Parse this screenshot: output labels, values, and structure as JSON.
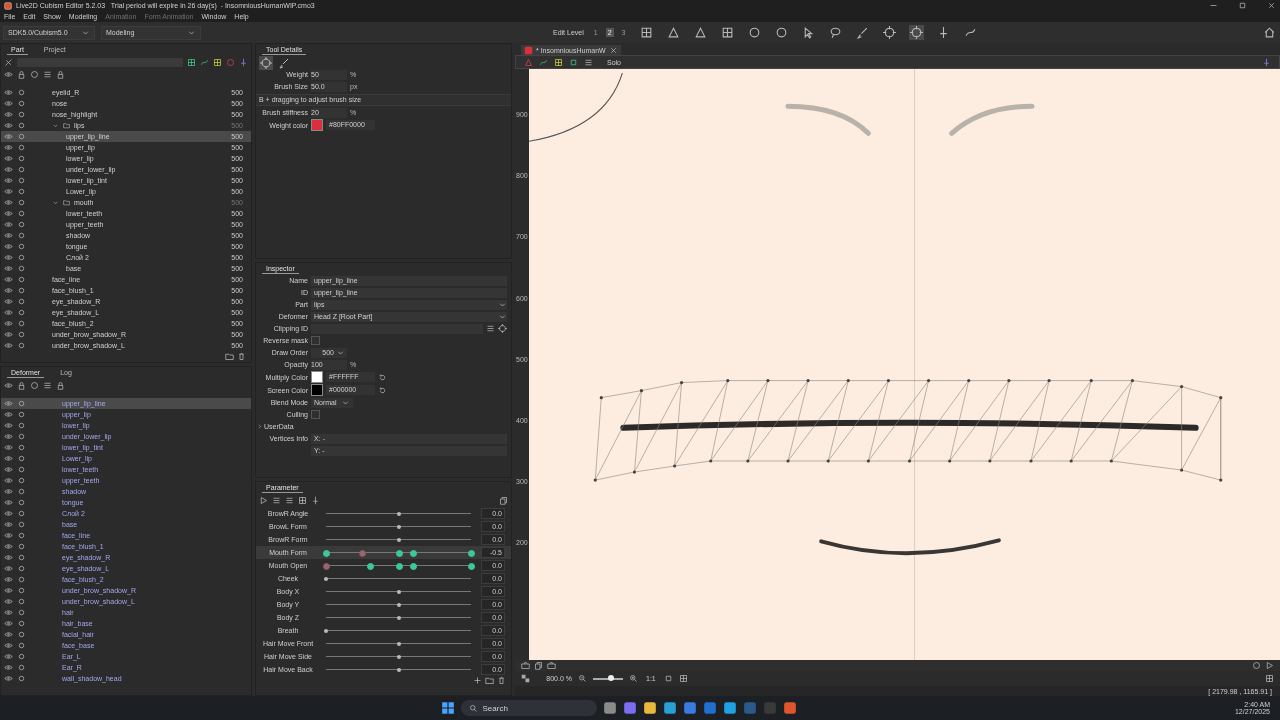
{
  "window": {
    "title": "Live2D Cubism Editor 5.2.03   Trial period will expire in 26 day(s)  - InsomniousHumanWIP.cmo3"
  },
  "menu": [
    {
      "label": "File",
      "disabled": false
    },
    {
      "label": "Edit",
      "disabled": false
    },
    {
      "label": "Show",
      "disabled": false
    },
    {
      "label": "Modeling",
      "disabled": false
    },
    {
      "label": "Animation",
      "disabled": true
    },
    {
      "label": "Form Animation",
      "disabled": true
    },
    {
      "label": "Window",
      "disabled": false
    },
    {
      "label": "Help",
      "disabled": false
    }
  ],
  "toolbar": {
    "sdk": "SDK5.0/Cubism5.0",
    "workspace": "Modeling",
    "edit_level_label": "Edit Level",
    "edit_levels": [
      {
        "label": "1",
        "selected": false
      },
      {
        "label": "2",
        "selected": true
      },
      {
        "label": "3",
        "selected": false
      }
    ]
  },
  "parts": {
    "tabs": [
      {
        "label": "Part",
        "selected": true
      },
      {
        "label": "Project",
        "selected": false
      }
    ],
    "items": [
      {
        "name": "eyelid_R",
        "order": "500",
        "selected": false
      },
      {
        "name": "nose",
        "order": "500",
        "selected": false
      },
      {
        "name": "nose_highlight",
        "order": "500",
        "selected": false
      },
      {
        "name": "lips",
        "order": "500",
        "selected": false,
        "expanded": true,
        "children": [
          {
            "name": "upper_lip_line",
            "order": "500",
            "selected": true
          },
          {
            "name": "upper_lip",
            "order": "500",
            "selected": false
          },
          {
            "name": "lower_lip",
            "order": "500",
            "selected": false
          },
          {
            "name": "under_lower_lip",
            "order": "500",
            "selected": false
          },
          {
            "name": "lower_lip_tint",
            "order": "500",
            "selected": false
          },
          {
            "name": "Lower_lip",
            "order": "500",
            "selected": false
          }
        ]
      },
      {
        "name": "mouth",
        "order": "500",
        "selected": false,
        "expanded": true,
        "children": [
          {
            "name": "lower_teeth",
            "order": "500",
            "selected": false
          },
          {
            "name": "upper_teeth",
            "order": "500",
            "selected": false
          },
          {
            "name": "shadow",
            "order": "500",
            "selected": false
          },
          {
            "name": "tongue",
            "order": "500",
            "selected": false
          },
          {
            "name": "Слой 2",
            "order": "500",
            "selected": false
          },
          {
            "name": "base",
            "order": "500",
            "selected": false
          }
        ]
      },
      {
        "name": "face_line",
        "order": "500",
        "selected": false
      },
      {
        "name": "face_blush_1",
        "order": "500",
        "selected": false
      },
      {
        "name": "eye_shadow_R",
        "order": "500",
        "selected": false
      },
      {
        "name": "eye_shadow_L",
        "order": "500",
        "selected": false
      },
      {
        "name": "face_blush_2",
        "order": "500",
        "selected": false
      },
      {
        "name": "under_brow_shadow_R",
        "order": "500",
        "selected": false
      },
      {
        "name": "under_brow_shadow_L",
        "order": "500",
        "selected": false
      }
    ]
  },
  "deformers": {
    "tabs": [
      {
        "label": "Deformer",
        "selected": true
      },
      {
        "label": "Log",
        "selected": false
      }
    ],
    "items": [
      {
        "name": "upper_lip_line",
        "selected": true
      },
      {
        "name": "upper_lip",
        "selected": false
      },
      {
        "name": "lower_lip",
        "selected": false
      },
      {
        "name": "under_lower_lip",
        "selected": false
      },
      {
        "name": "lower_lip_tint",
        "selected": false
      },
      {
        "name": "Lower_lip",
        "selected": false
      },
      {
        "name": "lower_teeth",
        "selected": false
      },
      {
        "name": "upper_teeth",
        "selected": false
      },
      {
        "name": "shadow",
        "selected": false
      },
      {
        "name": "tongue",
        "selected": false
      },
      {
        "name": "Слой 2",
        "selected": false
      },
      {
        "name": "base",
        "selected": false
      },
      {
        "name": "face_line",
        "selected": false
      },
      {
        "name": "face_blush_1",
        "selected": false
      },
      {
        "name": "eye_shadow_R",
        "selected": false
      },
      {
        "name": "eye_shadow_L",
        "selected": false
      },
      {
        "name": "face_blush_2",
        "selected": false
      },
      {
        "name": "under_brow_shadow_R",
        "selected": false
      },
      {
        "name": "under_brow_shadow_L",
        "selected": false
      },
      {
        "name": "hair",
        "selected": false
      },
      {
        "name": "hair_base",
        "selected": false
      },
      {
        "name": "facial_hair",
        "selected": false
      },
      {
        "name": "face_base",
        "selected": false
      },
      {
        "name": "Ear_L",
        "selected": false
      },
      {
        "name": "Ear_R",
        "selected": false
      },
      {
        "name": "wall_shadow_head",
        "selected": false
      }
    ]
  },
  "tool_details": {
    "title": "Tool Details",
    "fields": [
      {
        "kind": "number",
        "label": "Weight",
        "value": "50",
        "unit": "%"
      },
      {
        "kind": "number",
        "label": "Brush Size",
        "value": "50.0",
        "unit": "px"
      },
      {
        "kind": "hint",
        "text": "B + dragging to adjust brush size"
      },
      {
        "kind": "number",
        "label": "Brush stiffness",
        "value": "20",
        "unit": "%"
      },
      {
        "kind": "color",
        "label": "Weight color",
        "value": "#80FF0000",
        "color": "#d9303a"
      }
    ]
  },
  "inspector": {
    "title": "Inspector",
    "fields": [
      {
        "kind": "text",
        "label": "Name",
        "value": "upper_lip_line"
      },
      {
        "kind": "text",
        "label": "ID",
        "value": "upper_lip_line"
      },
      {
        "kind": "dropdown",
        "label": "Part",
        "value": "lips"
      },
      {
        "kind": "dropdown",
        "label": "Deformer",
        "value": "Head Z  [Root Part]"
      },
      {
        "kind": "list",
        "label": "Clipping ID"
      },
      {
        "kind": "checkbox",
        "label": "Reverse mask",
        "checked": false
      },
      {
        "kind": "spin",
        "label": "Draw Order",
        "value": "500"
      },
      {
        "kind": "number",
        "label": "Opacity",
        "value": "100",
        "unit": "%"
      },
      {
        "kind": "color",
        "label": "Multiply Color",
        "value": "#FFFFFF",
        "color": "#ffffff"
      },
      {
        "kind": "color",
        "label": "Screen Color",
        "value": "#000000",
        "color": "#000000"
      },
      {
        "kind": "select",
        "label": "Blend Mode",
        "value": "Normal"
      },
      {
        "kind": "checkbox",
        "label": "Culling",
        "checked": false
      },
      {
        "kind": "expander",
        "label": "UserData",
        "expanded": false
      },
      {
        "kind": "axis",
        "label": "Vertices Info",
        "axis": "X:",
        "value": "-"
      },
      {
        "kind": "axis",
        "axis": "Y:",
        "value": "-"
      }
    ]
  },
  "parameters": {
    "title": "Parameter",
    "items": [
      {
        "name": "BrowR Angle",
        "value": "0.0",
        "level": 0.5,
        "selected": false
      },
      {
        "name": "BrowL Form",
        "value": "0.0",
        "level": 0.5,
        "selected": false
      },
      {
        "name": "BrowR Form",
        "value": "0.0",
        "level": 0.5,
        "selected": false
      },
      {
        "name": "Mouth Form",
        "value": "-0.5",
        "level": 0.25,
        "selected": true,
        "keys": [
          {
            "level": 0,
            "selected": false
          },
          {
            "level": 0.25,
            "selected": true
          },
          {
            "level": 0.5,
            "selected": false
          },
          {
            "level": 0.6,
            "selected": false
          },
          {
            "level": 1,
            "selected": false
          }
        ]
      },
      {
        "name": "Mouth Open",
        "value": "0.0",
        "level": 0,
        "selected": false,
        "keys": [
          {
            "level": 0,
            "selected": true
          },
          {
            "level": 0.3,
            "selected": false
          },
          {
            "level": 0.5,
            "selected": false
          },
          {
            "level": 0.6,
            "selected": false
          },
          {
            "level": 1,
            "selected": false
          }
        ]
      },
      {
        "name": "Cheek",
        "value": "0.0",
        "level": 0,
        "selected": false
      },
      {
        "name": "Body X",
        "value": "0.0",
        "level": 0.5,
        "selected": false
      },
      {
        "name": "Body Y",
        "value": "0.0",
        "level": 0.5,
        "selected": false
      },
      {
        "name": "Body Z",
        "value": "0.0",
        "level": 0.5,
        "selected": false
      },
      {
        "name": "Breath",
        "value": "0.0",
        "level": 0,
        "selected": false
      },
      {
        "name": "Hair Move Front",
        "value": "0.0",
        "level": 0.5,
        "selected": false
      },
      {
        "name": "Hair Move Side",
        "value": "0.0",
        "level": 0.5,
        "selected": false
      },
      {
        "name": "Hair Move Back",
        "value": "0.0",
        "level": 0.5,
        "selected": false
      }
    ]
  },
  "canvas": {
    "tab": "* InsomniousHumanW",
    "solo": "Solo",
    "ruler": [
      "900",
      "800",
      "700",
      "600",
      "500",
      "400",
      "300",
      "200"
    ],
    "zoom": "800.0 %",
    "zoom_slider": {
      "level": 0.6
    },
    "ratio": "1:1",
    "coordinates": "[ 2179.98 , 1165.91 ]"
  },
  "taskbar": {
    "search": "Search",
    "time": "2:40 AM",
    "date": "12/27/2025"
  }
}
